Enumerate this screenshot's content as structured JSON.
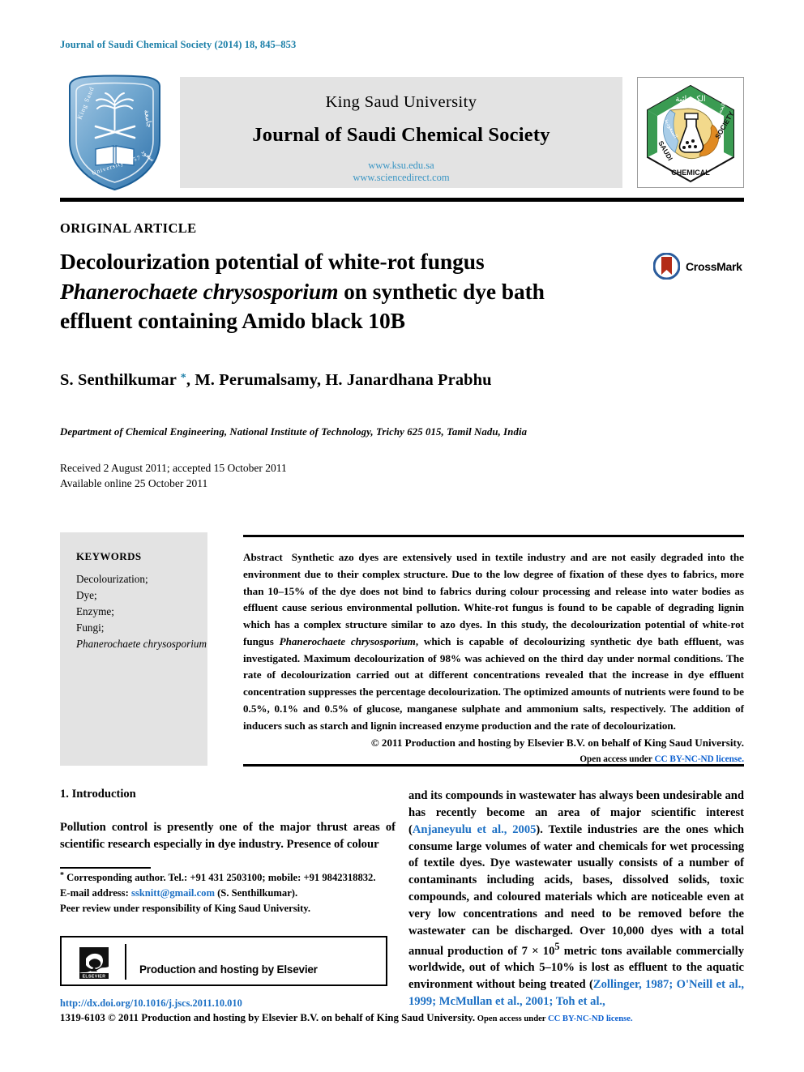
{
  "running_head": "Journal of Saudi Chemical Society (2014) 18, 845–853",
  "masthead": {
    "university": "King Saud University",
    "journal": "Journal of Saudi Chemical Society",
    "url_ksu": "www.ksu.edu.sa",
    "url_sciencedirect": "www.sciencedirect.com",
    "ksu_logo_alt": "king-saud-university-shield",
    "scs_logo_alt": "saudi-chemical-society-hexagon"
  },
  "article": {
    "type": "ORIGINAL ARTICLE",
    "title_line1": "Decolourization potential of white-rot fungus",
    "title_italic": "Phanerochaete chrysosporium",
    "title_line2_rest": " on synthetic dye bath",
    "title_line3": "effluent containing Amido black 10B",
    "crossmark_label": "CrossMark",
    "authors": "S. Senthilkumar ",
    "authors_rest": ", M. Perumalsamy, H. Janardhana Prabhu",
    "corresponding_marker": "*",
    "affiliation": "Department of Chemical Engineering, National Institute of Technology, Trichy 625 015, Tamil Nadu, India",
    "received": "Received 2 August 2011; accepted 15 October 2011",
    "available": "Available online 25 October 2011"
  },
  "keywords": {
    "heading": "KEYWORDS",
    "items": [
      "Decolourization;",
      "Dye;",
      "Enzyme;",
      "Fungi;"
    ],
    "italic_item": "Phanerochaete chrysosporium"
  },
  "abstract": {
    "label": "Abstract",
    "part1": "Synthetic azo dyes are extensively used in textile industry and are not easily degraded into the environment due to their complex structure. Due to the low degree of fixation of these dyes to fabrics, more than 10–15% of the dye does not bind to fabrics during colour processing and release into water bodies as effluent cause serious environmental pollution. White-rot fungus is found to be capable of degrading lignin which has a complex structure similar to azo dyes. In this study, the decolourization potential of white-rot fungus ",
    "italic_species": "Phanerochaete chrysosporium",
    "part2": ", which is capable of decolourizing synthetic dye bath effluent, was investigated. Maximum decolourization of 98% was achieved on the third day under normal conditions. The rate of decolourization carried out at different concentrations revealed that the increase in dye effluent concentration suppresses the percentage decolourization. The optimized amounts of nutrients were found to be 0.5%, 0.1% and 0.5% of glucose, manganese sulphate and ammonium salts, respectively. The addition of inducers such as starch and lignin increased enzyme production and the rate of decolourization.",
    "copyright": "© 2011 Production and hosting by Elsevier B.V. on behalf of King Saud University.",
    "open_access_prefix": "Open access under ",
    "open_access_link": "CC BY-NC-ND license."
  },
  "body": {
    "section_heading": "1. Introduction",
    "left_para": "Pollution control is presently one of the major thrust areas of scientific research especially in dye industry. Presence of colour",
    "right_part1": "and its compounds in wastewater has always been undesirable and has recently become an area of major scientific interest (",
    "right_cite1": "Anjaneyulu et al., 2005",
    "right_part2": "). Textile industries are the ones which consume large volumes of water and chemicals for wet processing of textile dyes. Dye wastewater usually consists of a number of contaminants including acids, bases, dissolved solids, toxic compounds, and coloured materials which are noticeable even at very low concentrations and need to be removed before the wastewater can be discharged. Over 10,000 dyes with a total annual production of 7 × 10",
    "right_sup": "5",
    "right_part3": " metric tons available commercially worldwide, out of which 5–10% is lost as effluent to the aquatic environment without being treated (",
    "right_cite2": "Zollinger, 1987; O'Neill et al., 1999; McMullan et al., 2001; Toh et al.,"
  },
  "footnote": {
    "marker": "*",
    "corresponding": " Corresponding author. Tel.: +91 431 2503100; mobile: +91 9842318832.",
    "email_label": "E-mail address: ",
    "email": "ssknitt@gmail.com",
    "email_suffix": " (S. Senthilkumar).",
    "peer_review": "Peer review under responsibility of King Saud University."
  },
  "elsevier": {
    "text": "Production and hosting by Elsevier",
    "logo_alt": "elsevier-tree-logo"
  },
  "footer": {
    "doi": "http://dx.doi.org/10.1016/j.jscs.2011.10.010",
    "issn_line": "1319-6103 © 2011 Production and hosting by Elsevier B.V. on behalf of King Saud University.",
    "open_access_prefix": " Open access under ",
    "open_access_link": "CC BY-NC-ND license."
  },
  "colors": {
    "journal_blue": "#1b7fa8",
    "link_blue": "#1b6fc4",
    "masthead_gray": "#e3e3e3"
  }
}
